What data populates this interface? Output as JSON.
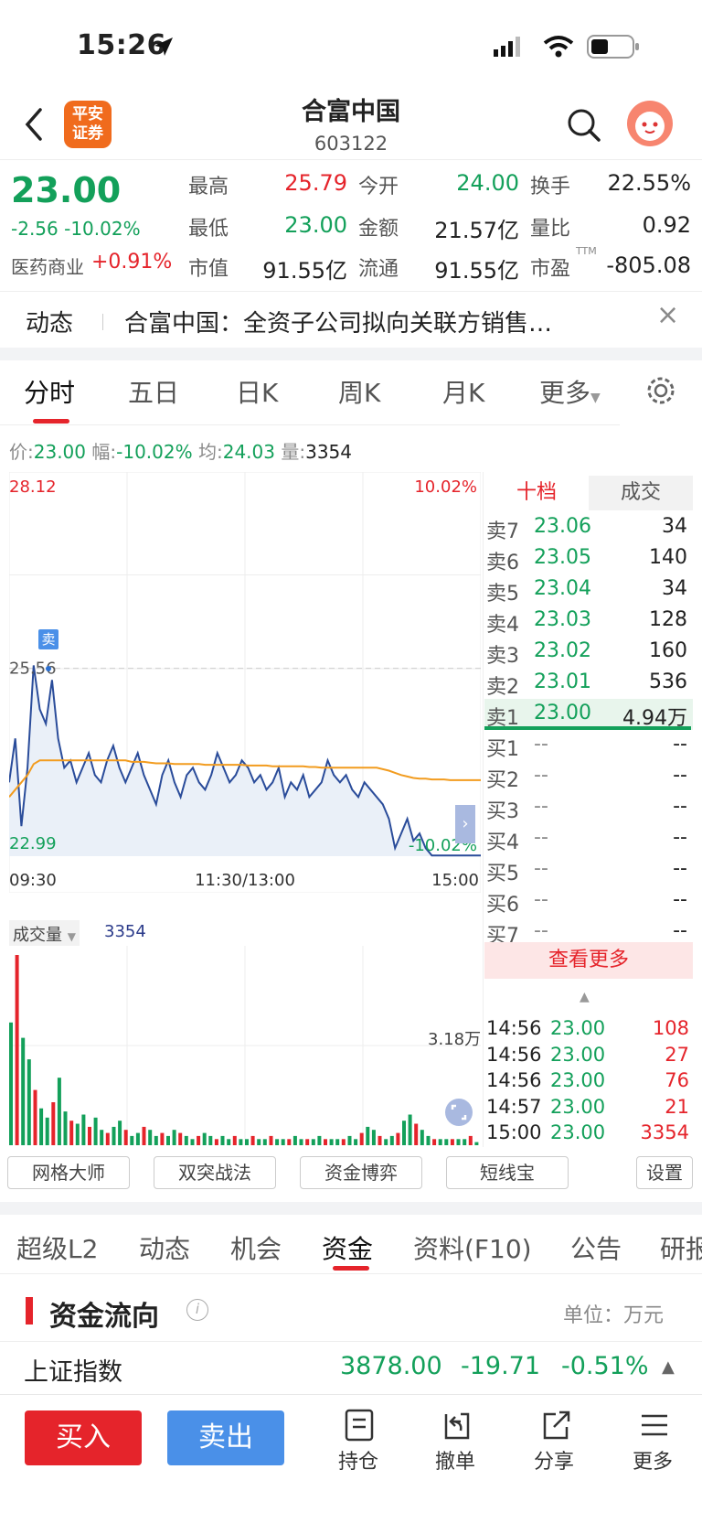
{
  "status": {
    "time": "15:26"
  },
  "header": {
    "title": "合富中国",
    "code": "603122",
    "logo_text_1": "平安",
    "logo_text_2": "证券"
  },
  "quote": {
    "price": "23.00",
    "change": "-2.56",
    "change_pct": "-10.02%",
    "sector_name": "医药商业",
    "sector_pct": "+0.91%",
    "fields": {
      "high_label": "最高",
      "high": "25.79",
      "low_label": "最低",
      "low": "23.00",
      "mktcap_label": "市值",
      "mktcap": "91.55亿",
      "open_label": "今开",
      "open": "24.00",
      "amount_label": "金额",
      "amount": "21.57亿",
      "float_label": "流通",
      "float": "91.55亿",
      "turnover_label": "换手",
      "turnover": "22.55%",
      "vol_ratio_label": "量比",
      "vol_ratio": "0.92",
      "pe_label": "市盈",
      "pe_sup": "TTM",
      "pe": "-805.08"
    }
  },
  "news": {
    "label": "动态",
    "text": "合富中国：全资子公司拟向关联方销售…",
    "close": "×"
  },
  "chart_tabs": [
    "分时",
    "五日",
    "日K",
    "周K",
    "月K",
    "更多"
  ],
  "info_row": {
    "price_label": "价:",
    "price": "23.00",
    "range_label": "幅:",
    "range": "-10.02%",
    "avg_label": "均:",
    "avg": "24.03",
    "vol_label": "量:",
    "vol": "3354"
  },
  "chart_data": [
    {
      "type": "line",
      "y_max_label": "28.12",
      "y_mid_label": "25.56",
      "y_min_label": "22.99",
      "pct_max_label": "10.02%",
      "pct_min_label": "-10.02%",
      "x_labels": [
        "09:30",
        "11:30/13:00",
        "15:00"
      ],
      "ylim": [
        22.99,
        28.12
      ],
      "marker_label": "卖",
      "series": [
        {
          "values": [
            24.0,
            24.6,
            23.4,
            24.2,
            25.6,
            25.0,
            24.8,
            25.4,
            24.6,
            24.2,
            24.3,
            24.0,
            24.2,
            24.4,
            24.1,
            24.0,
            24.3,
            24.5,
            24.2,
            24.0,
            24.2,
            24.4,
            24.1,
            23.9,
            23.7,
            24.1,
            24.3,
            24.0,
            23.8,
            24.1,
            24.2,
            24.0,
            23.9,
            24.1,
            24.4,
            24.2,
            24.0,
            24.1,
            24.3,
            24.2,
            24.0,
            24.1,
            23.9,
            24.0,
            24.2,
            23.8,
            24.0,
            23.9,
            24.1,
            23.8,
            23.9,
            24.0,
            24.3,
            24.1,
            24.0,
            24.1,
            23.9,
            23.8,
            24.0,
            23.9,
            23.8,
            23.7,
            23.5,
            23.1,
            23.3,
            23.5,
            23.2,
            23.3,
            23.1,
            23.0,
            23.0,
            23.0,
            23.0,
            23.0,
            23.0,
            23.0,
            23.0,
            23.0
          ]
        },
        {
          "values": [
            23.8,
            23.9,
            24.0,
            24.1,
            24.25,
            24.3,
            24.3,
            24.3,
            24.3,
            24.3,
            24.3,
            24.3,
            24.3,
            24.3,
            24.3,
            24.3,
            24.3,
            24.3,
            24.3,
            24.3,
            24.28,
            24.28,
            24.28,
            24.27,
            24.26,
            24.26,
            24.26,
            24.25,
            24.25,
            24.25,
            24.25,
            24.25,
            24.24,
            24.24,
            24.24,
            24.24,
            24.24,
            24.24,
            24.24,
            24.23,
            24.23,
            24.23,
            24.23,
            24.22,
            24.22,
            24.22,
            24.22,
            24.22,
            24.22,
            24.21,
            24.21,
            24.2,
            24.2,
            24.2,
            24.2,
            24.2,
            24.2,
            24.2,
            24.2,
            24.2,
            24.2,
            24.18,
            24.16,
            24.13,
            24.1,
            24.08,
            24.06,
            24.05,
            24.05,
            24.04,
            24.04,
            24.04,
            24.03,
            24.03,
            24.03,
            24.03,
            24.03,
            24.03
          ]
        }
      ]
    },
    {
      "type": "bar",
      "title": "成交量",
      "current_vol": "3354",
      "y_label": "3.18万",
      "values": [
        40,
        62,
        35,
        28,
        18,
        12,
        9,
        14,
        22,
        11,
        8,
        7,
        10,
        6,
        9,
        5,
        4,
        6,
        8,
        5,
        3,
        4,
        6,
        5,
        3,
        4,
        3,
        5,
        4,
        3,
        2,
        3,
        4,
        3,
        2,
        3,
        2,
        3,
        2,
        2,
        3,
        2,
        2,
        3,
        2,
        2,
        2,
        3,
        2,
        2,
        2,
        3,
        2,
        2,
        2,
        2,
        3,
        2,
        4,
        6,
        5,
        3,
        2,
        3,
        4,
        8,
        10,
        7,
        5,
        3,
        2,
        2,
        2,
        2,
        2,
        2,
        3,
        1
      ]
    }
  ],
  "order_book": {
    "tab_active": "十档",
    "tab_other": "成交",
    "asks": [
      {
        "label": "卖7",
        "price": "23.06",
        "vol": "34"
      },
      {
        "label": "卖6",
        "price": "23.05",
        "vol": "140"
      },
      {
        "label": "卖5",
        "price": "23.04",
        "vol": "34"
      },
      {
        "label": "卖4",
        "price": "23.03",
        "vol": "128"
      },
      {
        "label": "卖3",
        "price": "23.02",
        "vol": "160"
      },
      {
        "label": "卖2",
        "price": "23.01",
        "vol": "536"
      },
      {
        "label": "卖1",
        "price": "23.00",
        "vol": "4.94万"
      }
    ],
    "bids": [
      {
        "label": "买1",
        "price": "--",
        "vol": "--"
      },
      {
        "label": "买2",
        "price": "--",
        "vol": "--"
      },
      {
        "label": "买3",
        "price": "--",
        "vol": "--"
      },
      {
        "label": "买4",
        "price": "--",
        "vol": "--"
      },
      {
        "label": "买5",
        "price": "--",
        "vol": "--"
      },
      {
        "label": "买6",
        "price": "--",
        "vol": "--"
      },
      {
        "label": "买7",
        "price": "--",
        "vol": "--"
      }
    ],
    "more_label": "查看更多"
  },
  "trades": [
    {
      "time": "14:56",
      "price": "23.00",
      "vol": "108"
    },
    {
      "time": "14:56",
      "price": "23.00",
      "vol": "27"
    },
    {
      "time": "14:56",
      "price": "23.00",
      "vol": "76"
    },
    {
      "time": "14:57",
      "price": "23.00",
      "vol": "21"
    },
    {
      "time": "15:00",
      "price": "23.00",
      "vol": "3354"
    }
  ],
  "tools": [
    "网格大师",
    "双突战法",
    "资金博弈",
    "短线宝",
    "设置"
  ],
  "info_tabs": [
    "超级L2",
    "动态",
    "机会",
    "资金",
    "资料(F10)",
    "公告",
    "研报"
  ],
  "fund_flow": {
    "title": "资金流向",
    "unit": "单位：万元"
  },
  "index_row": {
    "name": "上证指数",
    "value": "3878.00",
    "change": "-19.71",
    "pct": "-0.51%"
  },
  "bottom_bar": {
    "buy": "买入",
    "sell": "卖出",
    "nav": [
      "持仓",
      "撤单",
      "分享",
      "更多"
    ]
  }
}
